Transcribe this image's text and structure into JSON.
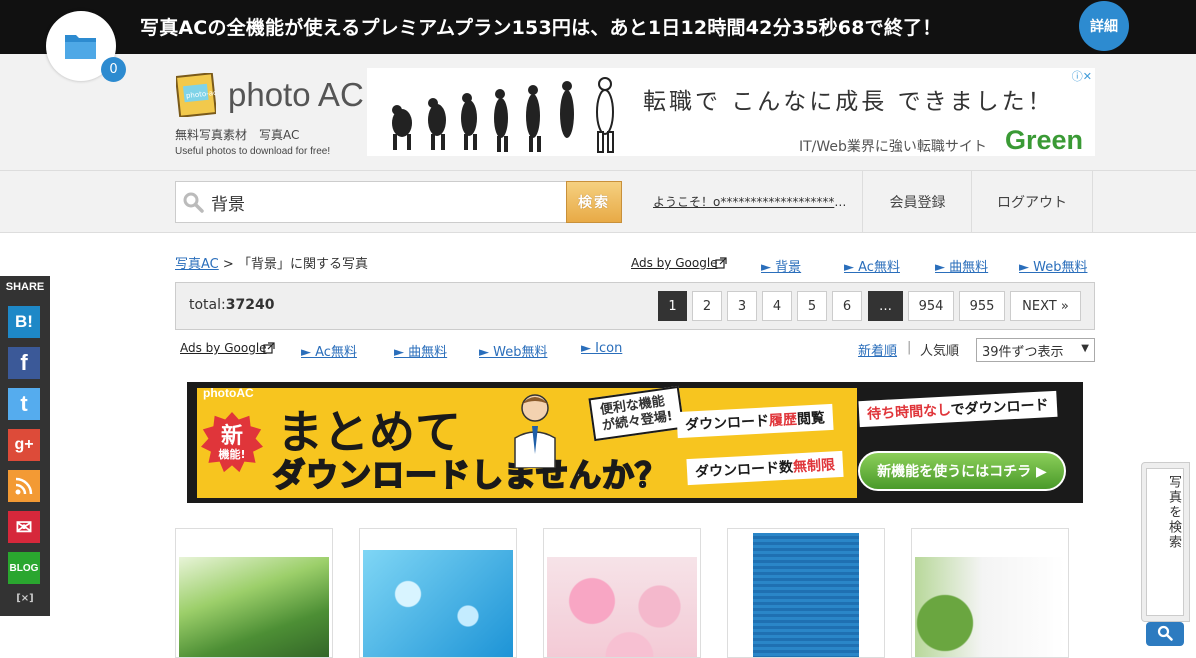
{
  "promo": {
    "text": "写真ACの全機能が使えるプレミアムプラン153円は、あと1日12時間42分35秒68で終了！",
    "detail_label": "詳細"
  },
  "folder": {
    "count": "0",
    "icon": "folder-icon"
  },
  "logo": {
    "badge_text": "photo-ac",
    "name": "photo AC",
    "sub1": "無料写真素材　写真AC",
    "sub2": "Useful photos to download for free!"
  },
  "top_ad": {
    "headline": "転職で こんなに成長 できました！",
    "sub": "IT/Web業界に強い転職サイト",
    "brand": "Green",
    "choice": "ⓘ✕"
  },
  "search": {
    "value": "背景",
    "button_label": "検索",
    "icon": "magnifier-icon"
  },
  "user": {
    "welcome": "ようこそ！o*******************さん",
    "register_label": "会員登録",
    "logout_label": "ログアウト"
  },
  "share": {
    "title": "SHARE",
    "items": [
      {
        "label": "B!",
        "name": "hatena",
        "color": "#1e88c7"
      },
      {
        "label": "f",
        "name": "facebook",
        "color": "#3b5998"
      },
      {
        "label": "t",
        "name": "twitter",
        "color": "#55acee"
      },
      {
        "label": "g+",
        "name": "google-plus",
        "color": "#dd4b39"
      },
      {
        "label": "rss",
        "name": "rss",
        "color": "#f39a34"
      },
      {
        "label": "✉",
        "name": "mail",
        "color": "#d6283b"
      },
      {
        "label": "BLOG",
        "name": "blog",
        "color": "#2aa62f"
      }
    ],
    "close_label": "[×]"
  },
  "breadcrumb": {
    "home": "写真AC",
    "separator": ">",
    "current": "「背景」に関する写真"
  },
  "ads_row1": {
    "label": "Ads by Google",
    "links": [
      "► 背景",
      "► Ac無料",
      "► 曲無料",
      "► Web無料"
    ]
  },
  "total": {
    "label": "total:",
    "count": "37240"
  },
  "pagination": {
    "pages": [
      "1",
      "2",
      "3",
      "4",
      "5",
      "6",
      "…",
      "954",
      "955"
    ],
    "next_label": "NEXT »"
  },
  "ads_row2": {
    "label": "Ads by Google",
    "links": [
      "► Ac無料",
      "► 曲無料",
      "► Web無料",
      "► Icon"
    ]
  },
  "sort": {
    "new": "新着順",
    "separator": "|",
    "popular": "人気順",
    "per_page": "39件ずつ表示"
  },
  "banner": {
    "logo": "photoAC",
    "new_badge_1": "新",
    "new_badge_2": "機能!",
    "main1": "まとめて",
    "main2": "ダウンロードしませんか？",
    "bubble": "便利な機能\nが続々登場!",
    "tag1_a": "ダウンロード",
    "tag1_b": "履歴",
    "tag1_c": "閲覧",
    "tag2_a": "ダウンロード数",
    "tag2_b": "無制限",
    "tag3_a": "待ち時間なし",
    "tag3_b": "でダウンロード",
    "cta": "新機能を使うにはコチラ ▶"
  },
  "side_search": {
    "label": "写真を検索",
    "icon": "magnifier-icon"
  }
}
